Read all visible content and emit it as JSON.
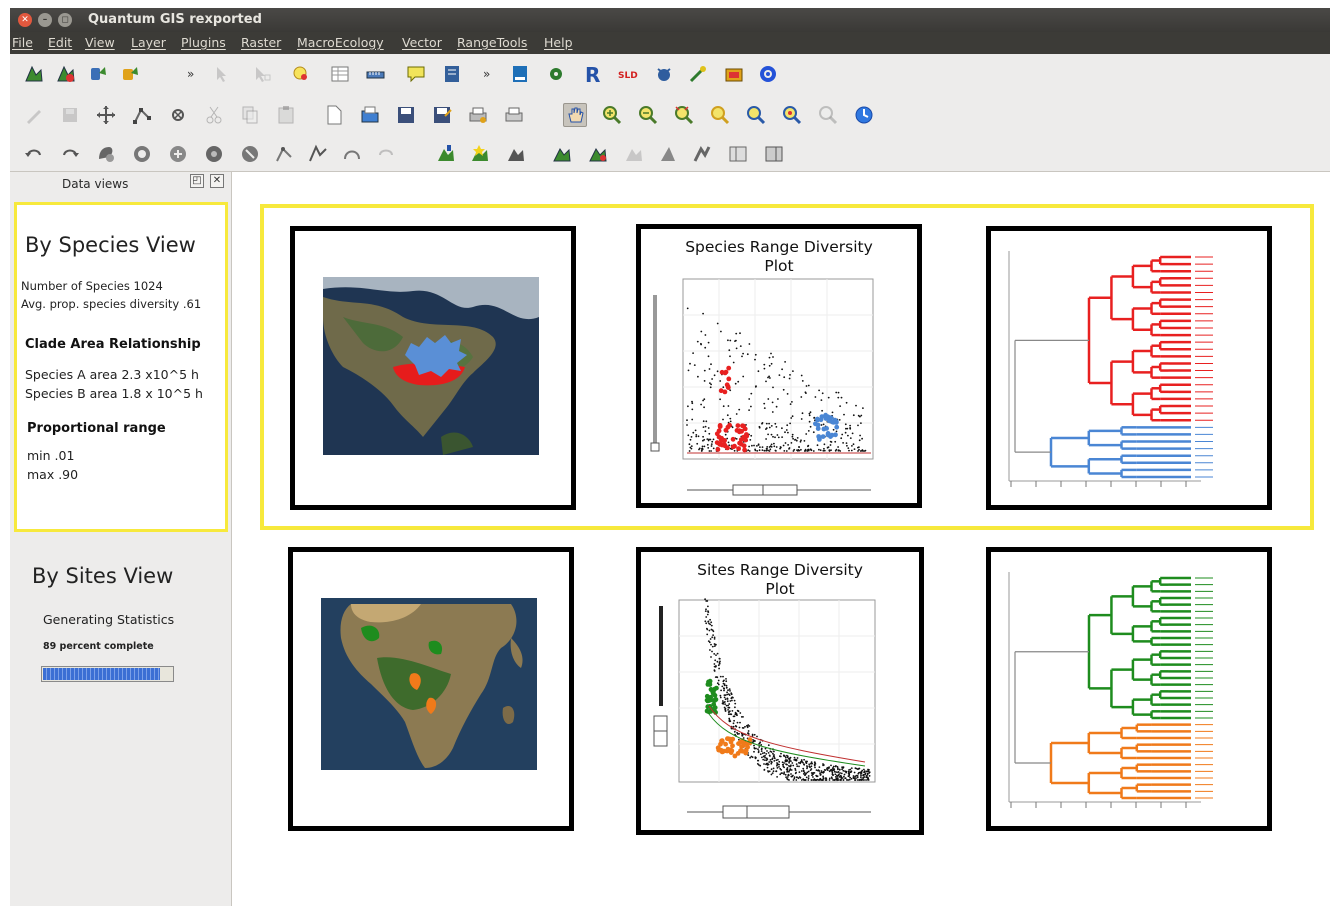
{
  "window": {
    "title": "Quantum GIS rexported",
    "buttons": [
      "close",
      "minimize",
      "maximize"
    ]
  },
  "menubar": {
    "items": [
      "File",
      "Edit",
      "View",
      "Layer",
      "Plugins",
      "Raster",
      "MacroEcology",
      "Vector",
      "RangeTools",
      "Help"
    ]
  },
  "toolbar": {
    "r_icon_label": "R",
    "sld_label": "SLD"
  },
  "dock": {
    "title": "Data views",
    "float_glyph": "◰",
    "close_glyph": "✕",
    "species_view": {
      "title": "By Species View",
      "num_species": "Number of Species 1024",
      "avg_diversity": "Avg. prop. species diversity .61",
      "clade_heading": "Clade Area Relationship",
      "species_a": "Species A area 2.3 x10^5 h",
      "species_b": "Species B area 1.8 x 10^5 h",
      "range_heading": "Proportional range",
      "min": "min .01",
      "max": "max .90"
    },
    "sites_view": {
      "title": "By Sites View",
      "status": "Generating Statistics",
      "progress_text": "89 percent complete",
      "progress_value": 0.89
    }
  },
  "canvas": {
    "species_row": {
      "map_region": "north-america",
      "plot_title": "Species Range Diversity Plot",
      "plot_title_line1": "Species Range Diversity",
      "plot_title_line2": "Plot",
      "dendrogram_colors": [
        "#e82020",
        "#4a86d4",
        "#888888"
      ]
    },
    "sites_row": {
      "map_region": "africa",
      "plot_title_line1": "Sites Range Diversity",
      "plot_title_line2": "Plot",
      "dendrogram_colors": [
        "#1e8c1e",
        "#f07a1a",
        "#888888"
      ]
    }
  },
  "colors": {
    "highlight": "#f7e93c",
    "title_bar": "#3c3b37",
    "toolbar_bg": "#edeceb",
    "species_red": "#e82020",
    "species_blue": "#4a86d4",
    "sites_green": "#1e8c1e",
    "sites_orange": "#f07a1a"
  }
}
